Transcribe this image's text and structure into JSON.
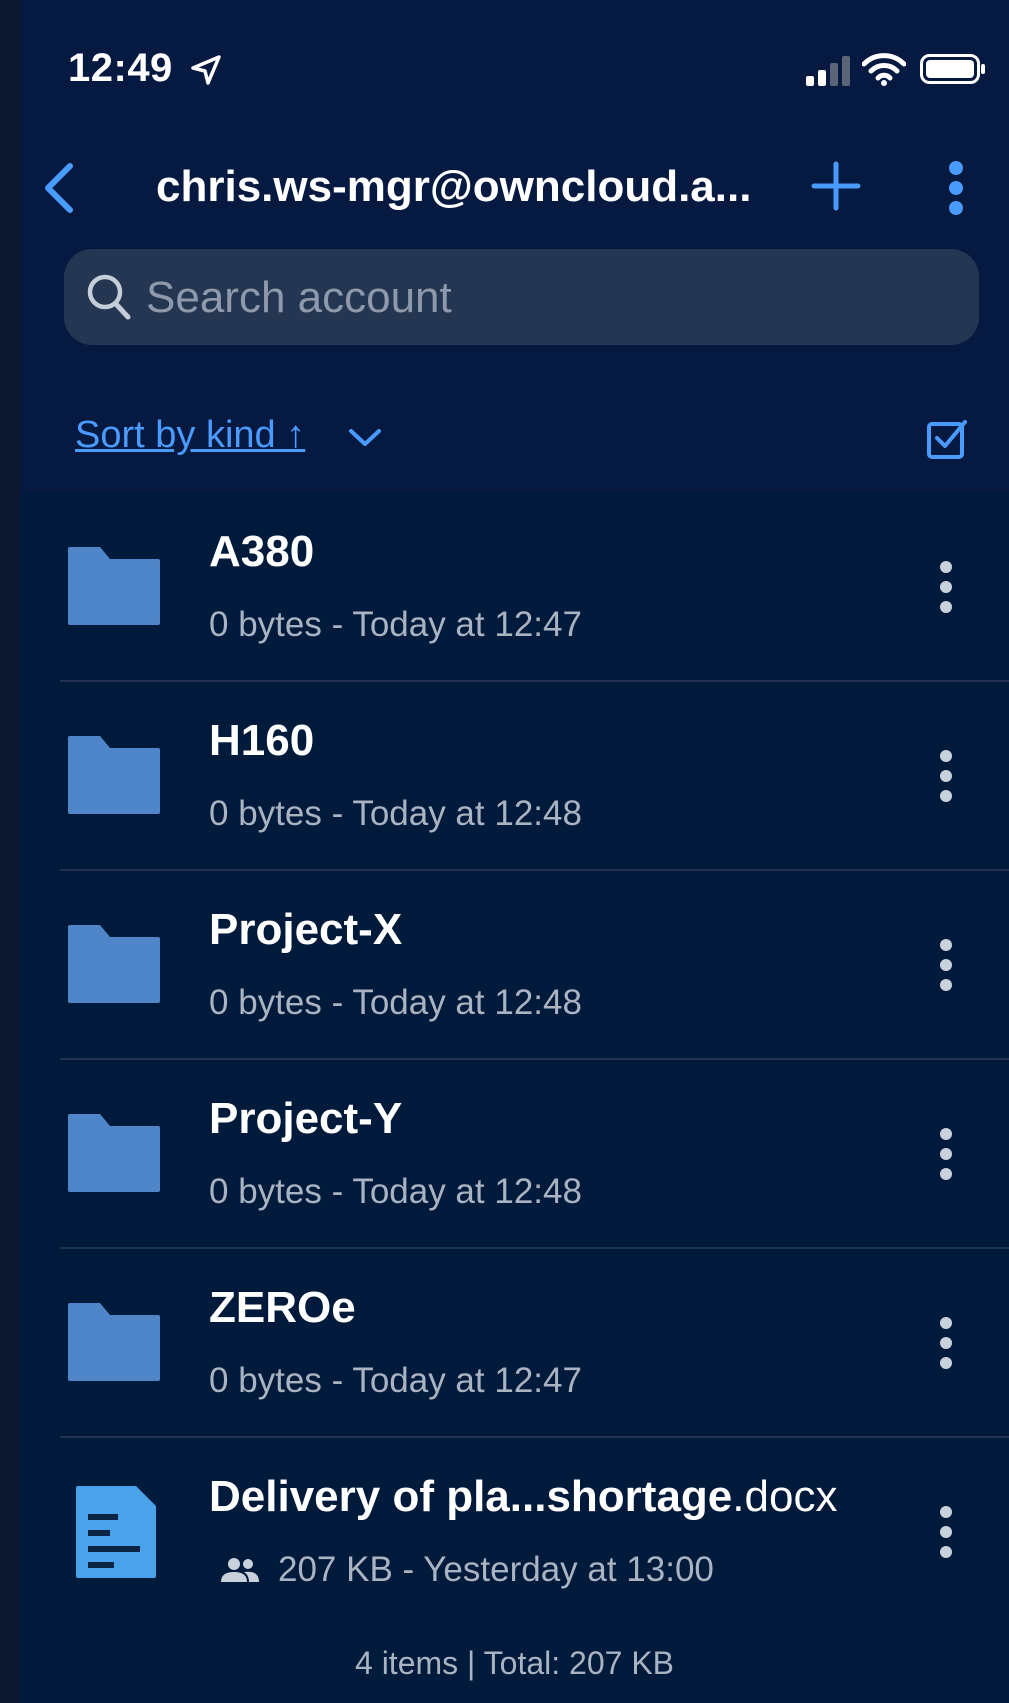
{
  "status_bar": {
    "time": "12:49"
  },
  "nav": {
    "title": "chris.ws-mgr@owncloud.a..."
  },
  "search": {
    "placeholder": "Search account"
  },
  "sort": {
    "label": "Sort by kind ↑"
  },
  "items": [
    {
      "name": "A380",
      "ext": "",
      "meta": "0 bytes - Today at 12:47",
      "kind": "folder"
    },
    {
      "name": "H160",
      "ext": "",
      "meta": "0 bytes - Today at 12:48",
      "kind": "folder"
    },
    {
      "name": "Project-X",
      "ext": "",
      "meta": "0 bytes - Today at 12:48",
      "kind": "folder"
    },
    {
      "name": "Project-Y",
      "ext": "",
      "meta": "0 bytes - Today at 12:48",
      "kind": "folder"
    },
    {
      "name": "ZEROe",
      "ext": "",
      "meta": "0 bytes - Today at 12:47",
      "kind": "folder"
    },
    {
      "name": "Delivery of pla...shortage",
      "ext": ".docx",
      "meta": "207 KB - Yesterday at 13:00",
      "kind": "file",
      "shared": true
    }
  ],
  "footer": {
    "summary": "4 items | Total: 207 KB"
  },
  "colors": {
    "accent": "#4a9bff",
    "folder": "#4f86c9",
    "document": "#4aa3ea",
    "background": "#001a3b"
  }
}
